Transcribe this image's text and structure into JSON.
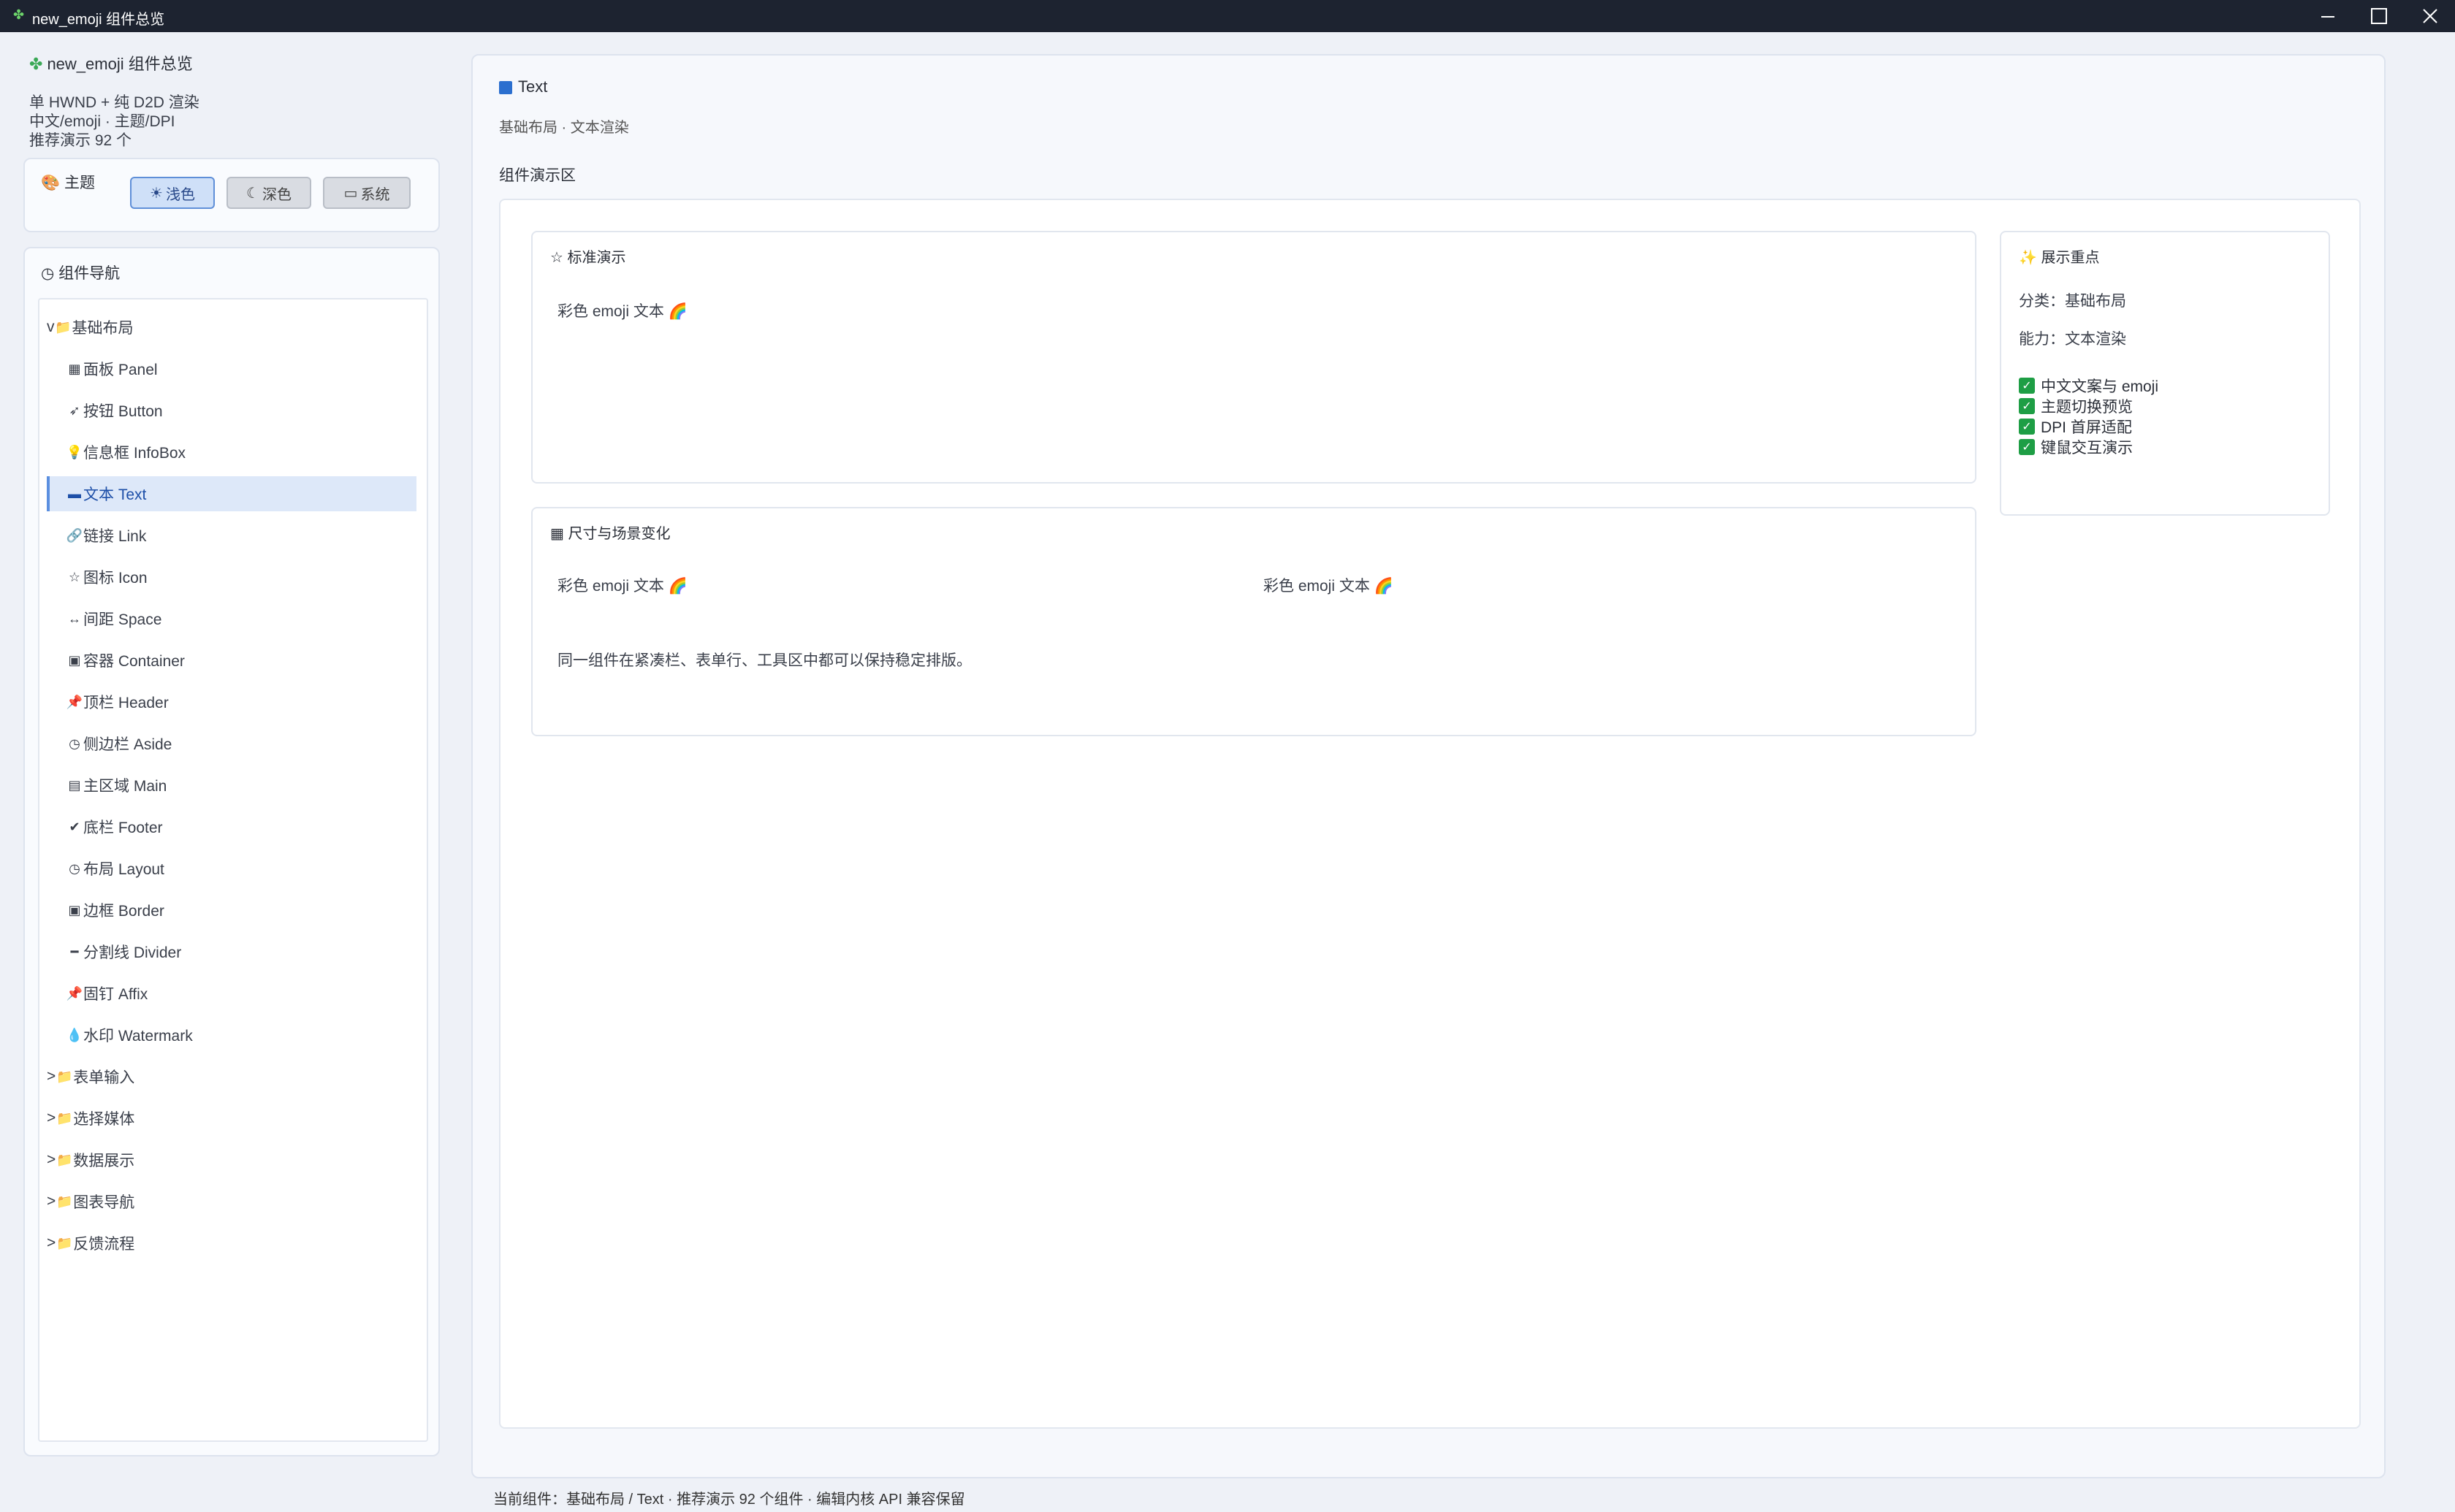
{
  "window": {
    "title": "new_emoji 组件总览"
  },
  "sidebar": {
    "app_title": "new_emoji 组件总览",
    "desc": [
      "单 HWND + 纯 D2D 渲染",
      "中文/emoji · 主题/DPI",
      "推荐演示 92 个"
    ],
    "theme": {
      "label": "主题",
      "buttons": [
        {
          "label": "浅色",
          "icon": "☀"
        },
        {
          "label": "深色",
          "icon": "☾"
        },
        {
          "label": "系统",
          "icon": "▭"
        }
      ]
    },
    "nav": {
      "header": "组件导航",
      "items": [
        {
          "label": "基础布局",
          "prefix": "v",
          "icon": "📁"
        },
        {
          "label": "面板 Panel",
          "icon": "▦"
        },
        {
          "label": "按钮 Button",
          "icon": "➶"
        },
        {
          "label": "信息框 InfoBox",
          "icon": "💡"
        },
        {
          "label": "文本 Text",
          "icon": "▬"
        },
        {
          "label": "链接 Link",
          "icon": "🔗"
        },
        {
          "label": "图标 Icon",
          "icon": "☆"
        },
        {
          "label": "间距 Space",
          "icon": "↔"
        },
        {
          "label": "容器 Container",
          "icon": "▣"
        },
        {
          "label": "顶栏 Header",
          "icon": "📌"
        },
        {
          "label": "侧边栏 Aside",
          "icon": "◷"
        },
        {
          "label": "主区域 Main",
          "icon": "▤"
        },
        {
          "label": "底栏 Footer",
          "icon": "✔"
        },
        {
          "label": "布局 Layout",
          "icon": "◷"
        },
        {
          "label": "边框 Border",
          "icon": "▣"
        },
        {
          "label": "分割线 Divider",
          "icon": "━"
        },
        {
          "label": "固钉 Affix",
          "icon": "📌"
        },
        {
          "label": "水印 Watermark",
          "icon": "💧"
        },
        {
          "label": "表单输入",
          "prefix": ">",
          "icon": "📁"
        },
        {
          "label": "选择媒体",
          "prefix": ">",
          "icon": "📁"
        },
        {
          "label": "数据展示",
          "prefix": ">",
          "icon": "📁"
        },
        {
          "label": "图表导航",
          "prefix": ">",
          "icon": "📁"
        },
        {
          "label": "反馈流程",
          "prefix": ">",
          "icon": "📁"
        }
      ]
    }
  },
  "main": {
    "title": "Text",
    "subtitle": "基础布局 · 文本渲染",
    "demo_label": "组件演示区",
    "standard": {
      "header": "标准演示",
      "text": "彩色 emoji 文本 🌈"
    },
    "size": {
      "header": "尺寸与场景变化",
      "text_a": "彩色 emoji 文本 🌈",
      "text_b": "彩色 emoji 文本 🌈",
      "note": "同一组件在紧凑栏、表单行、工具区中都可以保持稳定排版。"
    },
    "focus": {
      "header": "展示重点",
      "category": "分类：基础布局",
      "ability": "能力：文本渲染",
      "checks": [
        "中文文案与 emoji",
        "主题切换预览",
        "DPI 首屏适配",
        "键鼠交互演示"
      ]
    }
  },
  "status": {
    "text": "当前组件：基础布局 / Text · 推荐演示 92 个组件 · 编辑内核 API 兼容保留"
  },
  "colors": {
    "accent": "#5b8fe0",
    "selected_bg": "#dde8f9",
    "check": "#1e9e45",
    "titlebar": "#1d2330"
  }
}
